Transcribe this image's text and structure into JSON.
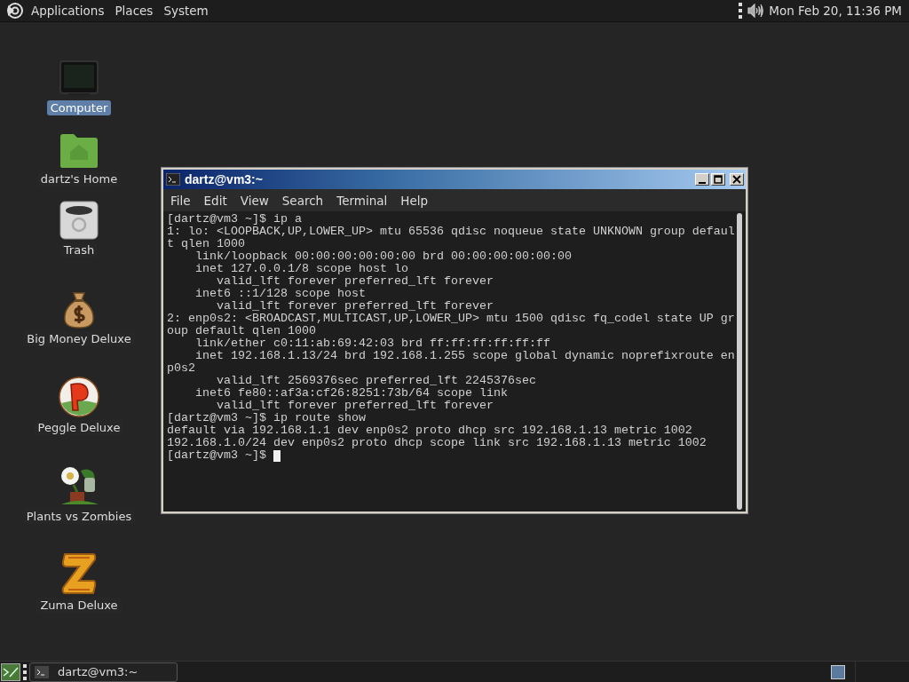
{
  "top_panel": {
    "menus": [
      "Applications",
      "Places",
      "System"
    ],
    "clock": "Mon Feb 20, 11:36 PM"
  },
  "desktop_icons": [
    {
      "label": "Computer",
      "kind": "computer",
      "selected": true
    },
    {
      "label": "dartz's Home",
      "kind": "folder",
      "selected": false
    },
    {
      "label": "Trash",
      "kind": "trash",
      "selected": false
    },
    {
      "label": "Big Money Deluxe",
      "kind": "moneybag",
      "selected": false
    },
    {
      "label": "Peggle Deluxe",
      "kind": "ball",
      "selected": false
    },
    {
      "label": "Plants vs Zombies",
      "kind": "plant",
      "selected": false
    },
    {
      "label": "Zuma Deluxe",
      "kind": "block",
      "selected": false
    }
  ],
  "terminal": {
    "title": "dartz@vm3:~",
    "menu": [
      "File",
      "Edit",
      "View",
      "Search",
      "Terminal",
      "Help"
    ],
    "lines": [
      "[dartz@vm3 ~]$ ip a",
      "1: lo: <LOOPBACK,UP,LOWER_UP> mtu 65536 qdisc noqueue state UNKNOWN group defaul",
      "t qlen 1000",
      "    link/loopback 00:00:00:00:00:00 brd 00:00:00:00:00:00",
      "    inet 127.0.0.1/8 scope host lo",
      "       valid_lft forever preferred_lft forever",
      "    inet6 ::1/128 scope host",
      "       valid_lft forever preferred_lft forever",
      "2: enp0s2: <BROADCAST,MULTICAST,UP,LOWER_UP> mtu 1500 qdisc fq_codel state UP gr",
      "oup default qlen 1000",
      "    link/ether c0:11:ab:69:42:03 brd ff:ff:ff:ff:ff:ff",
      "    inet 192.168.1.13/24 brd 192.168.1.255 scope global dynamic noprefixroute en",
      "p0s2",
      "       valid_lft 2569376sec preferred_lft 2245376sec",
      "    inet6 fe80::af3a:cf26:8251:73b/64 scope link",
      "       valid_lft forever preferred_lft forever",
      "[dartz@vm3 ~]$ ip route show",
      "default via 192.168.1.1 dev enp0s2 proto dhcp src 192.168.1.13 metric 1002",
      "192.168.1.0/24 dev enp0s2 proto dhcp scope link src 192.168.1.13 metric 1002"
    ],
    "prompt": "[dartz@vm3 ~]$ ",
    "cursor": true
  },
  "taskbar": {
    "tasks": [
      {
        "label": "dartz@vm3:~",
        "selected": false
      }
    ]
  }
}
